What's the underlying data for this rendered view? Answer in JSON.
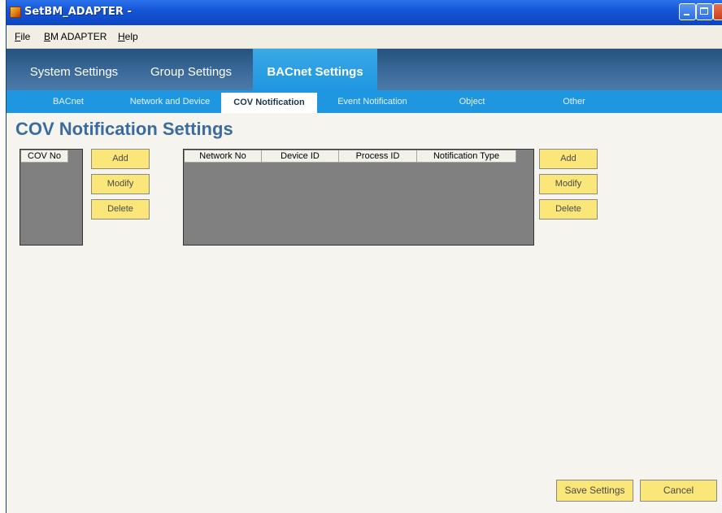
{
  "window": {
    "title": "SetBM_ADAPTER -"
  },
  "menu": {
    "file": {
      "underline": "F",
      "rest": "ile"
    },
    "bm_adapter": {
      "underline": "B",
      "rest": "M ADAPTER"
    },
    "help": {
      "underline": "H",
      "rest": "elp"
    }
  },
  "main_tabs": [
    {
      "label": "System Settings",
      "active": false
    },
    {
      "label": "Group Settings",
      "active": false
    },
    {
      "label": "BACnet Settings",
      "active": true
    }
  ],
  "sub_tabs": [
    {
      "label": "BACnet",
      "active": false
    },
    {
      "label": "Network and Device",
      "active": false
    },
    {
      "label": "COV Notification",
      "active": true
    },
    {
      "label": "Event Notification",
      "active": false
    },
    {
      "label": "Object",
      "active": false
    },
    {
      "label": "Other",
      "active": false
    }
  ],
  "page_title": "COV Notification Settings",
  "cov_list": {
    "columns": [
      "COV No"
    ],
    "rows": []
  },
  "cov_buttons": {
    "add": "Add",
    "modify": "Modify",
    "delete": "Delete"
  },
  "notification_list": {
    "columns": [
      "Network No",
      "Device ID",
      "Process ID",
      "Notification Type"
    ],
    "rows": []
  },
  "notification_buttons": {
    "add": "Add",
    "modify": "Modify",
    "delete": "Delete"
  },
  "footer": {
    "save": "Save Settings",
    "cancel": "Cancel"
  },
  "colors": {
    "title_bar": "#1656d6",
    "main_tab_bar": "#3b6a9a",
    "active_tab": "#1f97e0",
    "page_title": "#3b6c9c",
    "button": "#fbe67a",
    "list_background": "#808080"
  }
}
